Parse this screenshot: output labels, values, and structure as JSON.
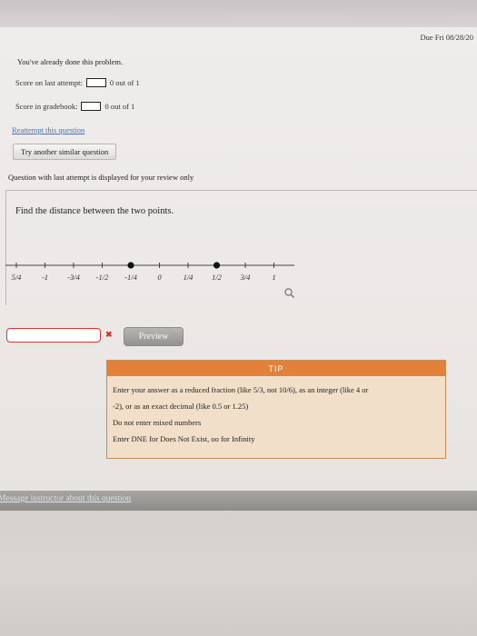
{
  "header": {
    "due_text": "Due Fri 08/28/20"
  },
  "status": {
    "done_text": "You've already done this problem.",
    "last_attempt_label": "Score on last attempt:",
    "last_attempt_value": "0 out of 1",
    "gradebook_label": "Score in gradebook:",
    "gradebook_value": "0 out of 1"
  },
  "actions": {
    "reattempt_link": "Reattempt this question",
    "similar_button": "Try another similar question",
    "review_note": "Question with last attempt is displayed for your review only"
  },
  "question": {
    "text": "Find the distance between the two points."
  },
  "number_line": {
    "tick_labels": [
      "5/4",
      "-1",
      "-3/4",
      "-1/2",
      "-1/4",
      "0",
      "1/4",
      "1/2",
      "3/4",
      "1"
    ],
    "tick_values": [
      -1.25,
      -1,
      -0.75,
      -0.5,
      -0.25,
      0,
      0.25,
      0.5,
      0.75,
      1
    ],
    "points": [
      -0.25,
      0.5
    ]
  },
  "answer": {
    "input_value": "",
    "error_mark": "✖",
    "preview_button": "Preview"
  },
  "tip": {
    "header": "TIP",
    "lines": [
      "Enter your answer as a reduced fraction (like 5/3, not 10/6), as an integer (like 4 or",
      "-2), or as an exact decimal (like 0.5 or 1.25)",
      "Do not enter mixed numbers",
      "Enter DNE for Does Not Exist, oo for Infinity"
    ]
  },
  "footer": {
    "message_link": "Message instructor about this question"
  },
  "icons": {
    "zoom": "magnifier-icon"
  }
}
